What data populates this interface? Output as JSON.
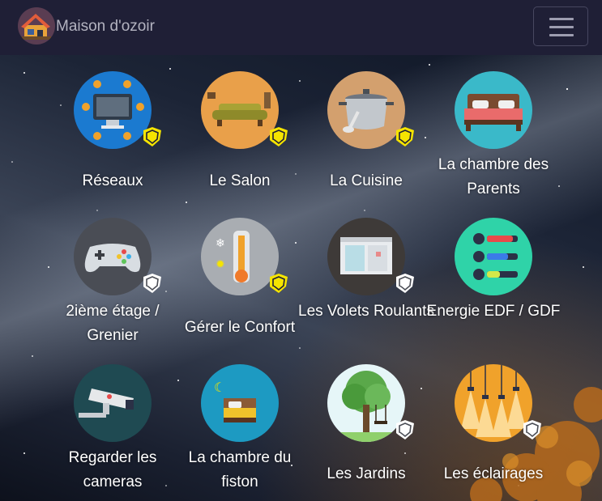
{
  "navbar": {
    "brand": "Maison d'ozoir",
    "logo_icon": "house-icon",
    "menu_icon": "hamburger-menu-icon"
  },
  "rooms": [
    {
      "label": "Réseaux",
      "icon": "computer-network-icon",
      "shield": "yellow"
    },
    {
      "label": "Le Salon",
      "icon": "sofa-icon",
      "shield": "yellow"
    },
    {
      "label": "La Cuisine",
      "icon": "cooking-pot-icon",
      "shield": "yellow"
    },
    {
      "label": "La chambre des Parents",
      "icon": "double-bed-icon",
      "shield": "none"
    },
    {
      "label": "2ième étage / Grenier",
      "icon": "gamepad-icon",
      "shield": "white"
    },
    {
      "label": "Gérer le Confort",
      "icon": "thermometer-icon",
      "shield": "yellow"
    },
    {
      "label": "Les Volets Roulants",
      "icon": "window-shutter-icon",
      "shield": "white"
    },
    {
      "label": "Energie EDF / GDF",
      "icon": "energy-gauge-icon",
      "shield": "none"
    },
    {
      "label": "Regarder les cameras",
      "icon": "security-camera-icon",
      "shield": "none"
    },
    {
      "label": "La chambre du fiston",
      "icon": "child-bed-icon",
      "shield": "none"
    },
    {
      "label": "Les Jardins",
      "icon": "tree-icon",
      "shield": "white"
    },
    {
      "label": "Les éclairages",
      "icon": "ceiling-lamps-icon",
      "shield": "white"
    }
  ],
  "colors": {
    "navbar_bg": "#1f1f36",
    "shield_active": "#f5e400",
    "shield_inactive": "#ffffff"
  }
}
